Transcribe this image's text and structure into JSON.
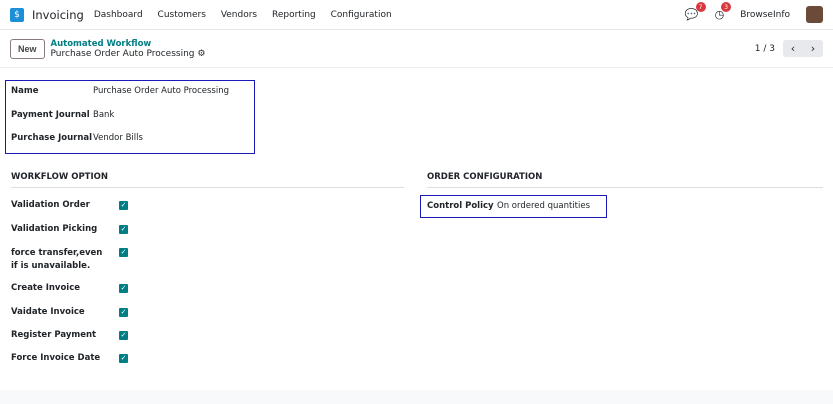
{
  "nav": {
    "app": "Invoicing",
    "menu": [
      "Dashboard",
      "Customers",
      "Vendors",
      "Reporting",
      "Configuration"
    ],
    "messages_count": "7",
    "activities_count": "3",
    "user": "BrowseInfo"
  },
  "control": {
    "new": "New",
    "breadcrumb_parent": "Automated Workflow",
    "breadcrumb_current": "Purchase Order Auto Processing",
    "pager": "1 / 3"
  },
  "fields": [
    {
      "label": "Name",
      "value": "Purchase Order Auto Processing"
    },
    {
      "label": "Payment Journal",
      "value": "Bank"
    },
    {
      "label": "Purchase Journal",
      "value": "Vendor Bills"
    }
  ],
  "workflow": {
    "title": "WORKFLOW OPTION",
    "options": [
      {
        "label": "Validation Order",
        "checked": true
      },
      {
        "label": "Validation Picking",
        "checked": true
      },
      {
        "label": "force transfer,even if is unavailable.",
        "checked": true
      },
      {
        "label": "Create Invoice",
        "checked": true
      },
      {
        "label": "Vaidate Invoice",
        "checked": true
      },
      {
        "label": "Register Payment",
        "checked": true
      },
      {
        "label": "Force Invoice Date",
        "checked": true
      }
    ]
  },
  "order": {
    "title": "ORDER CONFIGURATION",
    "label": "Control Policy",
    "value": "On ordered quantities"
  }
}
